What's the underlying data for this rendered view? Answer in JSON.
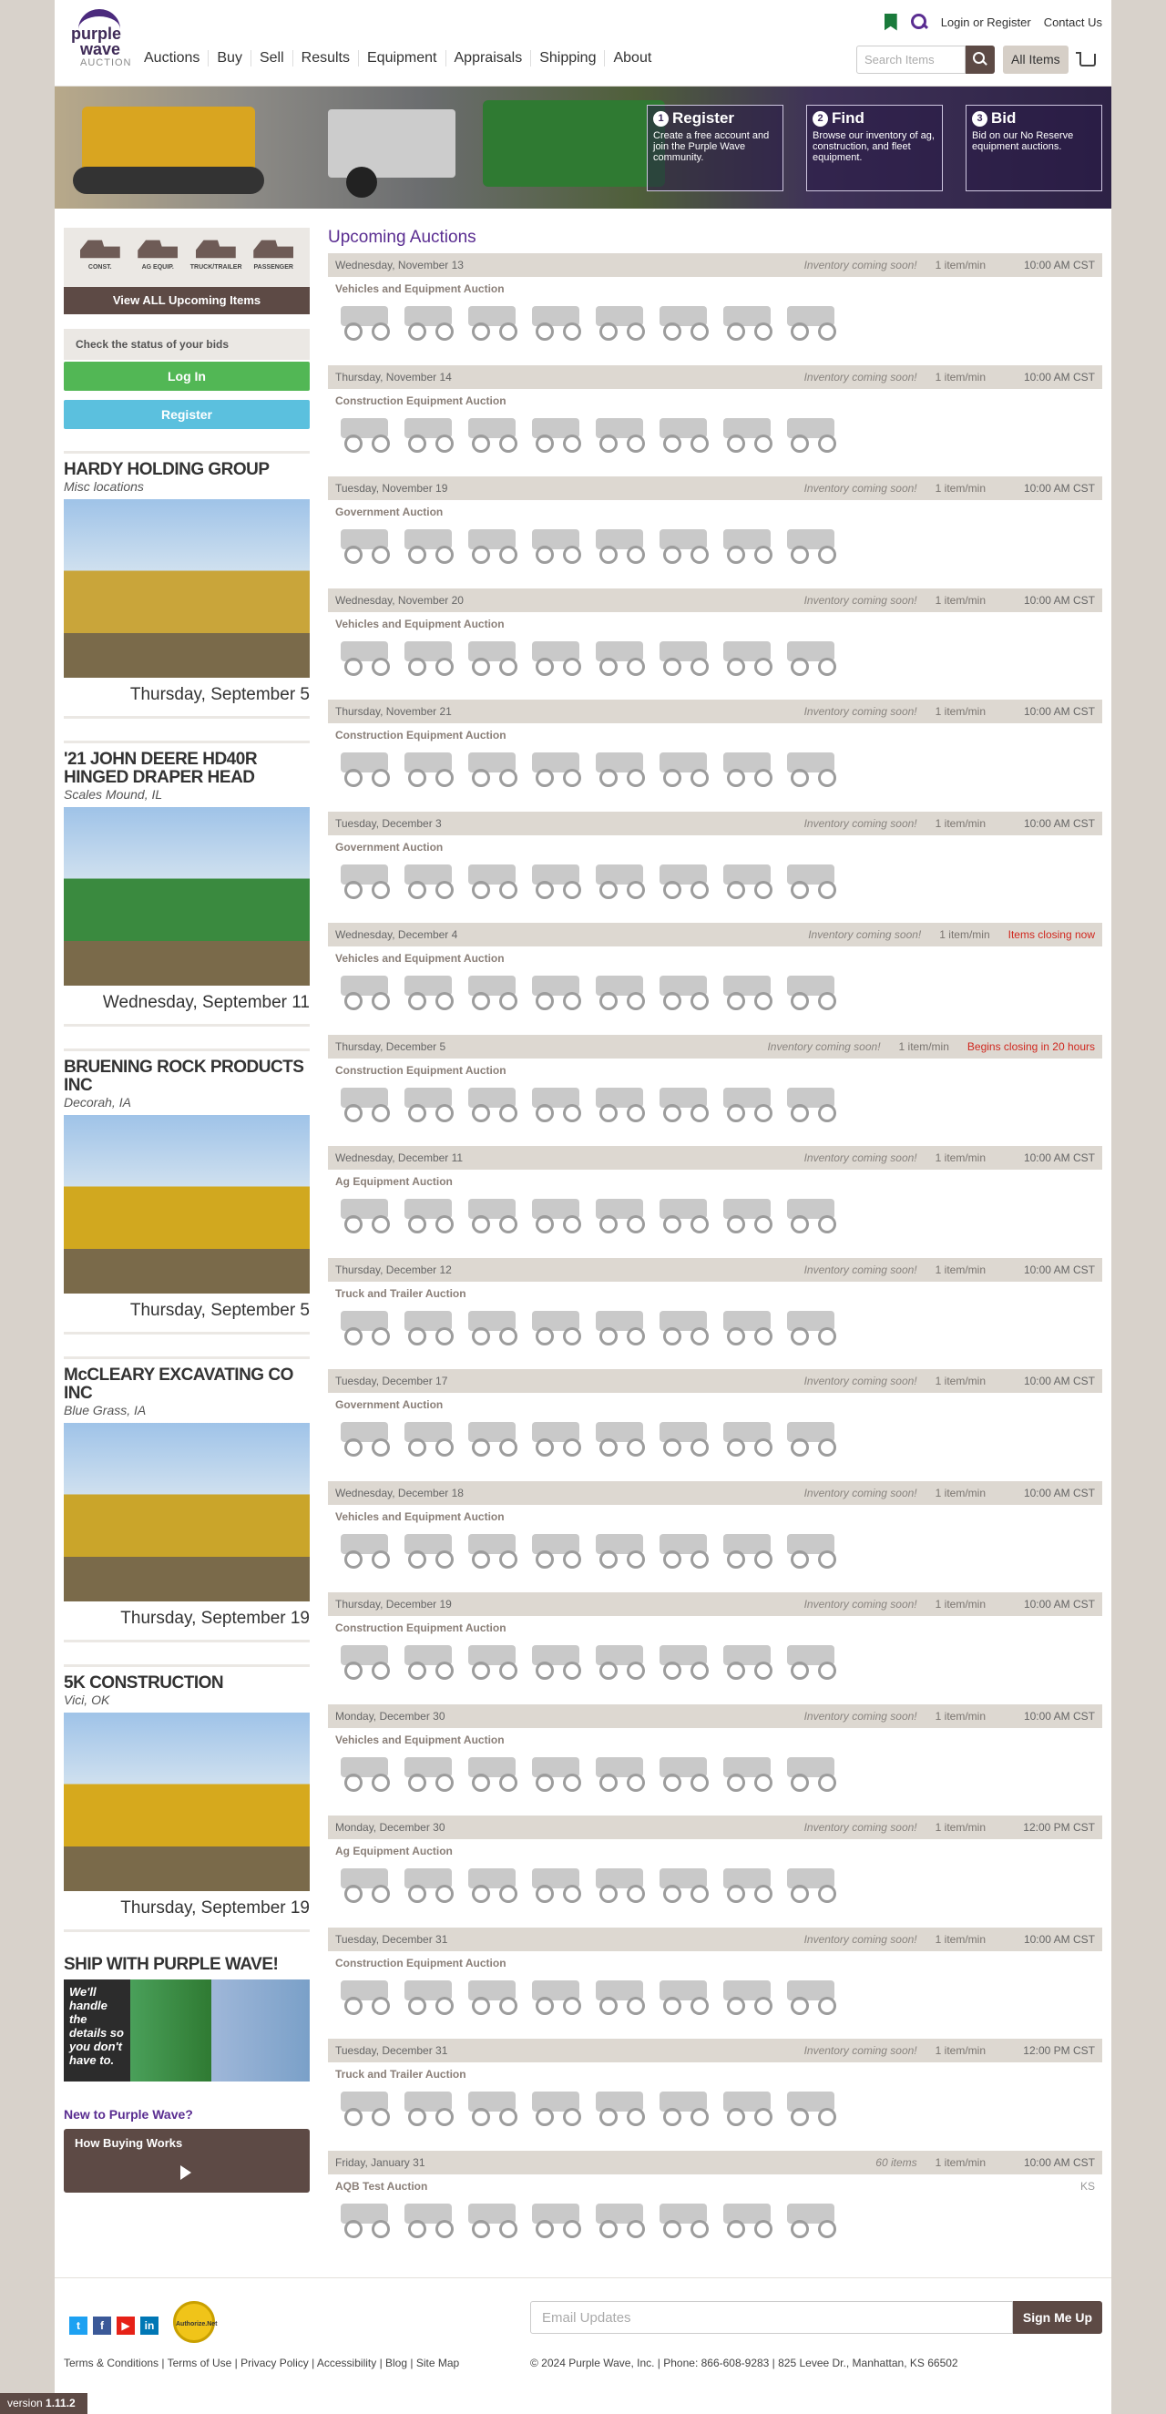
{
  "header": {
    "logo_line1": "purple",
    "logo_line2": "wave",
    "logo_line3": "AUCTION",
    "login_link": "Login or Register",
    "contact_link": "Contact Us",
    "nav": [
      "Auctions",
      "Buy",
      "Sell",
      "Results",
      "Equipment",
      "Appraisals",
      "Shipping",
      "About"
    ],
    "search_placeholder": "Search Items",
    "all_items_label": "All Items"
  },
  "banner": {
    "boxes": [
      {
        "num": "1",
        "title": "Register",
        "desc": "Create a free account and join the Purple Wave community."
      },
      {
        "num": "2",
        "title": "Find",
        "desc": "Browse our inventory of ag, construction, and fleet equipment."
      },
      {
        "num": "3",
        "title": "Bid",
        "desc": "Bid on our No Reserve equipment auctions."
      }
    ]
  },
  "sidebar": {
    "categories": [
      "CONST.",
      "AG EQUIP.",
      "TRUCK/TRAILER",
      "PASSENGER"
    ],
    "view_all": "View ALL Upcoming Items",
    "status_text": "Check the status of your bids",
    "login_btn": "Log In",
    "register_btn": "Register",
    "featured": [
      {
        "title": "HARDY HOLDING GROUP",
        "location": "Misc locations",
        "date": "Thursday, September 5",
        "color": "#c9a53a"
      },
      {
        "title": "'21 JOHN DEERE HD40R HINGED DRAPER HEAD",
        "location": "Scales Mound, IL",
        "date": "Wednesday, September 11",
        "color": "#3a8a3f"
      },
      {
        "title": "BRUENING ROCK PRODUCTS INC",
        "location": "Decorah, IA",
        "date": "Thursday, September 5",
        "color": "#d1a81f"
      },
      {
        "title": "McCLEARY EXCAVATING CO INC",
        "location": "Blue Grass, IA",
        "date": "Thursday, September 19",
        "color": "#caa52a"
      },
      {
        "title": "5K CONSTRUCTION",
        "location": "Vici, OK",
        "date": "Thursday, September 19",
        "color": "#d6a91d"
      }
    ],
    "ship_title": "SHIP WITH PURPLE WAVE!",
    "ship_tagline": "We'll handle the details so you don't have to.",
    "new_to": "New to Purple Wave?",
    "how_buying": "How Buying Works"
  },
  "main": {
    "title": "Upcoming Auctions",
    "auctions": [
      {
        "date": "Wednesday, November 13",
        "name": "Vehicles and Equipment Auction",
        "inventory": "Inventory coming soon!",
        "rate": "1 item/min",
        "time": "10:00 AM CST",
        "alert": false,
        "state": ""
      },
      {
        "date": "Thursday, November 14",
        "name": "Construction Equipment Auction",
        "inventory": "Inventory coming soon!",
        "rate": "1 item/min",
        "time": "10:00 AM CST",
        "alert": false,
        "state": ""
      },
      {
        "date": "Tuesday, November 19",
        "name": "Government Auction",
        "inventory": "Inventory coming soon!",
        "rate": "1 item/min",
        "time": "10:00 AM CST",
        "alert": false,
        "state": ""
      },
      {
        "date": "Wednesday, November 20",
        "name": "Vehicles and Equipment Auction",
        "inventory": "Inventory coming soon!",
        "rate": "1 item/min",
        "time": "10:00 AM CST",
        "alert": false,
        "state": ""
      },
      {
        "date": "Thursday, November 21",
        "name": "Construction Equipment Auction",
        "inventory": "Inventory coming soon!",
        "rate": "1 item/min",
        "time": "10:00 AM CST",
        "alert": false,
        "state": ""
      },
      {
        "date": "Tuesday, December 3",
        "name": "Government Auction",
        "inventory": "Inventory coming soon!",
        "rate": "1 item/min",
        "time": "10:00 AM CST",
        "alert": false,
        "state": ""
      },
      {
        "date": "Wednesday, December 4",
        "name": "Vehicles and Equipment Auction",
        "inventory": "Inventory coming soon!",
        "rate": "1 item/min",
        "time": "Items closing now",
        "alert": true,
        "state": ""
      },
      {
        "date": "Thursday, December 5",
        "name": "Construction Equipment Auction",
        "inventory": "Inventory coming soon!",
        "rate": "1 item/min",
        "time": "Begins closing in 20 hours",
        "alert": true,
        "state": ""
      },
      {
        "date": "Wednesday, December 11",
        "name": "Ag Equipment Auction",
        "inventory": "Inventory coming soon!",
        "rate": "1 item/min",
        "time": "10:00 AM CST",
        "alert": false,
        "state": ""
      },
      {
        "date": "Thursday, December 12",
        "name": "Truck and Trailer Auction",
        "inventory": "Inventory coming soon!",
        "rate": "1 item/min",
        "time": "10:00 AM CST",
        "alert": false,
        "state": ""
      },
      {
        "date": "Tuesday, December 17",
        "name": "Government Auction",
        "inventory": "Inventory coming soon!",
        "rate": "1 item/min",
        "time": "10:00 AM CST",
        "alert": false,
        "state": ""
      },
      {
        "date": "Wednesday, December 18",
        "name": "Vehicles and Equipment Auction",
        "inventory": "Inventory coming soon!",
        "rate": "1 item/min",
        "time": "10:00 AM CST",
        "alert": false,
        "state": ""
      },
      {
        "date": "Thursday, December 19",
        "name": "Construction Equipment Auction",
        "inventory": "Inventory coming soon!",
        "rate": "1 item/min",
        "time": "10:00 AM CST",
        "alert": false,
        "state": ""
      },
      {
        "date": "Monday, December 30",
        "name": "Vehicles and Equipment Auction",
        "inventory": "Inventory coming soon!",
        "rate": "1 item/min",
        "time": "10:00 AM CST",
        "alert": false,
        "state": ""
      },
      {
        "date": "Monday, December 30",
        "name": "Ag Equipment Auction",
        "inventory": "Inventory coming soon!",
        "rate": "1 item/min",
        "time": "12:00 PM CST",
        "alert": false,
        "state": ""
      },
      {
        "date": "Tuesday, December 31",
        "name": "Construction Equipment Auction",
        "inventory": "Inventory coming soon!",
        "rate": "1 item/min",
        "time": "10:00 AM CST",
        "alert": false,
        "state": ""
      },
      {
        "date": "Tuesday, December 31",
        "name": "Truck and Trailer Auction",
        "inventory": "Inventory coming soon!",
        "rate": "1 item/min",
        "time": "12:00 PM CST",
        "alert": false,
        "state": ""
      },
      {
        "date": "Friday, January 31",
        "name": "AQB Test Auction",
        "inventory": "60 items",
        "rate": "1 item/min",
        "time": "10:00 AM CST",
        "alert": false,
        "state": "KS"
      }
    ]
  },
  "footer": {
    "social": [
      "t",
      "f",
      "▶",
      "in"
    ],
    "authorize_label": "Authorize.Net",
    "links": "Terms & Conditions | Terms of Use | Privacy Policy | Accessibility | Blog | Site Map",
    "email_placeholder": "Email Updates",
    "signup_btn": "Sign Me Up",
    "copyright": "© 2024 Purple Wave, Inc. | Phone: 866-608-9283 | 825 Levee Dr., Manhattan, KS 66502",
    "version_label": "version",
    "version": "1.11.2"
  }
}
